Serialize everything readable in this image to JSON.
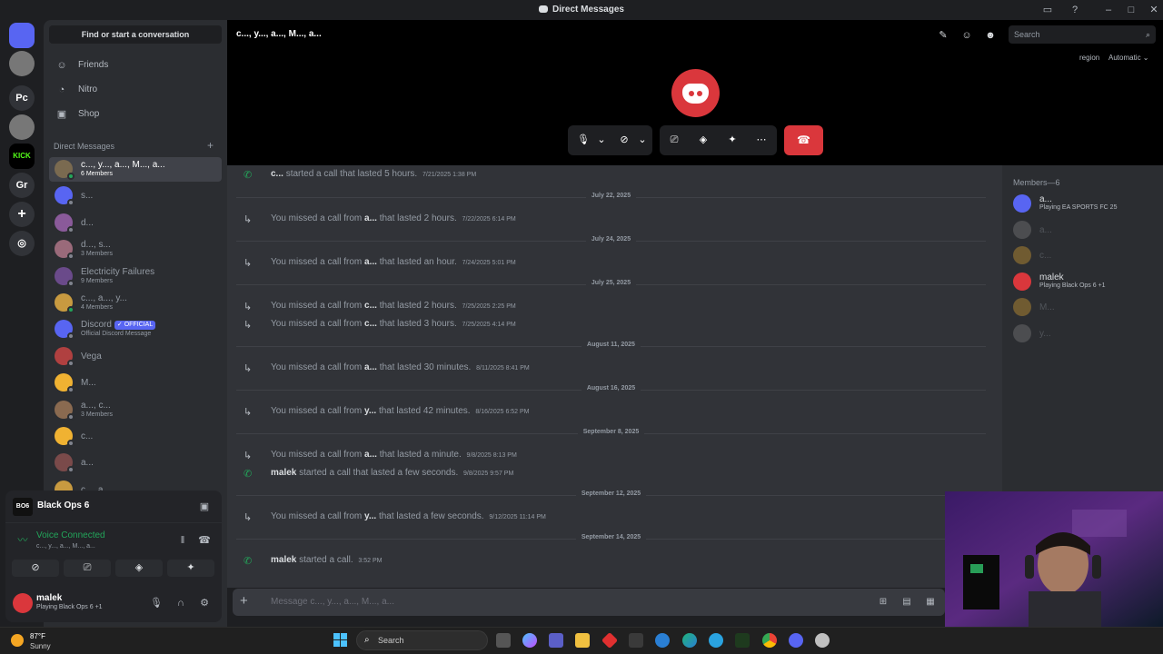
{
  "window": {
    "title": "Direct Messages"
  },
  "servers": [
    {
      "label": "",
      "kind": "discord-home"
    },
    {
      "label": "",
      "kind": "avatar"
    },
    {
      "label": "Pc"
    },
    {
      "label": "",
      "kind": "avatar"
    },
    {
      "label": "KICK"
    },
    {
      "label": "Gr"
    },
    {
      "label": "+",
      "kind": "add"
    },
    {
      "label": "",
      "kind": "discover"
    }
  ],
  "sidebar": {
    "find_label": "Find or start a conversation",
    "nav": [
      {
        "label": "Friends",
        "icon": "friends-icon"
      },
      {
        "label": "Nitro",
        "icon": "nitro-icon"
      },
      {
        "label": "Shop",
        "icon": "shop-icon"
      }
    ],
    "dm_header": "Direct Messages",
    "dms": [
      {
        "name": "c..., y..., a..., M..., a...",
        "sub": "6 Members",
        "active": true,
        "color": "#7a6a50",
        "online": true
      },
      {
        "name": "s...",
        "sub": "",
        "color": "#5865f2",
        "online": false
      },
      {
        "name": "d...",
        "sub": "",
        "color": "#8a5a9a",
        "online": false
      },
      {
        "name": "d..., s...",
        "sub": "3 Members",
        "color": "#9a6a7a",
        "online": false
      },
      {
        "name": "Electricity Failures",
        "sub": "9 Members",
        "color": "#6a4a8a",
        "online": false
      },
      {
        "name": "c..., a..., y...",
        "sub": "4 Members",
        "color": "#c89a40",
        "online": true
      },
      {
        "name": "Discord",
        "sub": "Official Discord Message",
        "badge": "✓ OFFICIAL",
        "color": "#5865f2",
        "online": false
      },
      {
        "name": "Vega",
        "sub": "",
        "color": "#b04040",
        "online": false
      },
      {
        "name": "M...",
        "sub": "",
        "color": "#f0b232",
        "online": false
      },
      {
        "name": "a..., c...",
        "sub": "3 Members",
        "color": "#8a6a50",
        "online": false
      },
      {
        "name": "c...",
        "sub": "",
        "color": "#f0b232",
        "online": false
      },
      {
        "name": "a...",
        "sub": "",
        "color": "#7a4a4a",
        "online": false
      },
      {
        "name": "c..., a...",
        "sub": "",
        "color": "#c89a40",
        "online": false
      }
    ]
  },
  "panel": {
    "game_name": "Black Ops 6",
    "game_icon": "BO6",
    "voice_label": "Voice Connected",
    "voice_channel": "c..., y..., a..., M..., a...",
    "user_name": "malek",
    "user_status": "Playing Black Ops 6 +1"
  },
  "call": {
    "channel_name": "c..., y..., a..., M..., a...",
    "search_placeholder": "Search",
    "region_label": "region",
    "region_value": "Automatic"
  },
  "messages": [
    {
      "type": "msg",
      "kind": "in",
      "user": "c...",
      "text": "started a call that lasted 5 hours.",
      "time": "7/21/2025 1:38 PM"
    },
    {
      "type": "sep",
      "label": "July 22, 2025"
    },
    {
      "type": "msg",
      "kind": "miss",
      "pre": "You missed a call from",
      "user": "a...",
      "text": "that lasted 2 hours.",
      "time": "7/22/2025 6:14 PM"
    },
    {
      "type": "sep",
      "label": "July 24, 2025"
    },
    {
      "type": "msg",
      "kind": "miss",
      "pre": "You missed a call from",
      "user": "a...",
      "text": "that lasted an hour.",
      "time": "7/24/2025 5:01 PM"
    },
    {
      "type": "sep",
      "label": "July 25, 2025"
    },
    {
      "type": "msg",
      "kind": "miss",
      "pre": "You missed a call from",
      "user": "c...",
      "text": "that lasted 2 hours.",
      "time": "7/25/2025 2:25 PM"
    },
    {
      "type": "msg",
      "kind": "miss",
      "pre": "You missed a call from",
      "user": "c...",
      "text": "that lasted 3 hours.",
      "time": "7/25/2025 4:14 PM"
    },
    {
      "type": "sep",
      "label": "August 11, 2025"
    },
    {
      "type": "msg",
      "kind": "miss",
      "pre": "You missed a call from",
      "user": "a...",
      "text": "that lasted 30 minutes.",
      "time": "8/11/2025 8:41 PM"
    },
    {
      "type": "sep",
      "label": "August 16, 2025"
    },
    {
      "type": "msg",
      "kind": "miss",
      "pre": "You missed a call from",
      "user": "y...",
      "text": "that lasted 42 minutes.",
      "time": "8/16/2025 6:52 PM"
    },
    {
      "type": "sep",
      "label": "September 8, 2025"
    },
    {
      "type": "msg",
      "kind": "miss",
      "pre": "You missed a call from",
      "user": "a...",
      "text": "that lasted a minute.",
      "time": "9/8/2025 8:13 PM"
    },
    {
      "type": "msg",
      "kind": "in",
      "user": "malek",
      "text": "started a call that lasted a few seconds.",
      "time": "9/8/2025 9:57 PM"
    },
    {
      "type": "sep",
      "label": "September 12, 2025"
    },
    {
      "type": "msg",
      "kind": "miss",
      "pre": "You missed a call from",
      "user": "y...",
      "text": "that lasted a few seconds.",
      "time": "9/12/2025 11:14 PM"
    },
    {
      "type": "sep",
      "label": "September 14, 2025"
    },
    {
      "type": "msg",
      "kind": "in",
      "user": "malek",
      "text": "started a call.",
      "time": "3:52 PM"
    }
  ],
  "composer": {
    "placeholder": "Message c..., y..., a..., M..., a..."
  },
  "members": {
    "header": "Members—6",
    "list": [
      {
        "name": "a...",
        "status": "Playing EA SPORTS FC 25",
        "color": "#5865f2",
        "off": false
      },
      {
        "name": "a...",
        "status": "",
        "color": "#8a8a8a",
        "off": true
      },
      {
        "name": "c...",
        "status": "",
        "color": "#f0b232",
        "off": true
      },
      {
        "name": "malek",
        "status": "Playing Black Ops 6 +1",
        "color": "#da373c",
        "off": false
      },
      {
        "name": "M...",
        "status": "",
        "color": "#f0b232",
        "off": true
      },
      {
        "name": "y...",
        "status": "",
        "color": "#8a8a8a",
        "off": true
      }
    ]
  },
  "taskbar": {
    "temp": "87°F",
    "condition": "Sunny",
    "search_label": "Search"
  }
}
